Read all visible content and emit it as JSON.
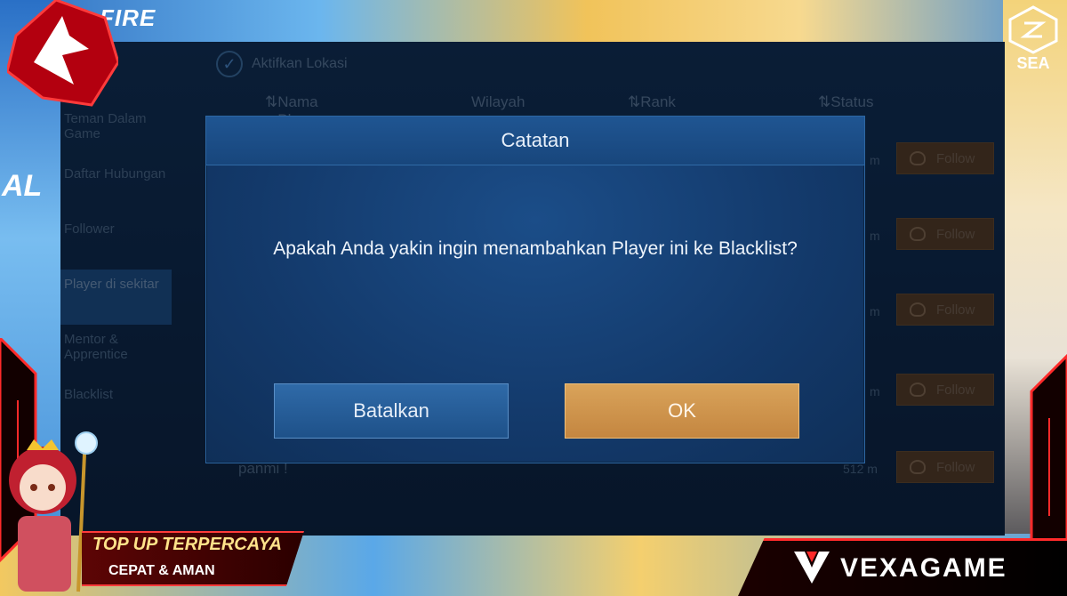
{
  "stream_overlay": {
    "top_left_logo_text": "FIRE",
    "left_side_text": "AL",
    "region_badge": "SEA",
    "promo_banner": {
      "line1": "TOP UP TERPERCAYA",
      "line2": "CEPAT & AMAN"
    },
    "brand": "VEXAGAME"
  },
  "game": {
    "activate_location_label": "Aktifkan Lokasi",
    "table_headers": [
      "Nama Player",
      "Wilayah",
      "Rank",
      "Status"
    ],
    "side_menu": [
      {
        "label": "Teman Dalam Game",
        "active": false
      },
      {
        "label": "Daftar Hubungan",
        "active": false
      },
      {
        "label": "Follower",
        "active": false
      },
      {
        "label": "Player di sekitar",
        "active": true
      },
      {
        "label": "Mentor & Apprentice",
        "active": false
      },
      {
        "label": "Blacklist",
        "active": false
      }
    ],
    "rows": [
      {
        "distance": "m",
        "follow": "Follow"
      },
      {
        "distance": "m",
        "follow": "Follow"
      },
      {
        "distance": "m",
        "follow": "Follow"
      },
      {
        "distance": "m",
        "follow": "Follow"
      },
      {
        "distance": "512 m",
        "follow": "Follow"
      }
    ],
    "background_player_name": "panmi !"
  },
  "modal": {
    "title": "Catatan",
    "message": "Apakah Anda yakin ingin menambahkan Player ini ke Blacklist?",
    "cancel_label": "Batalkan",
    "ok_label": "OK"
  },
  "colors": {
    "modal_bg": "#13396a",
    "cancel_button": "#2f6aa8",
    "ok_button": "#d9a35a",
    "overlay_red": "#ff2a2a"
  }
}
